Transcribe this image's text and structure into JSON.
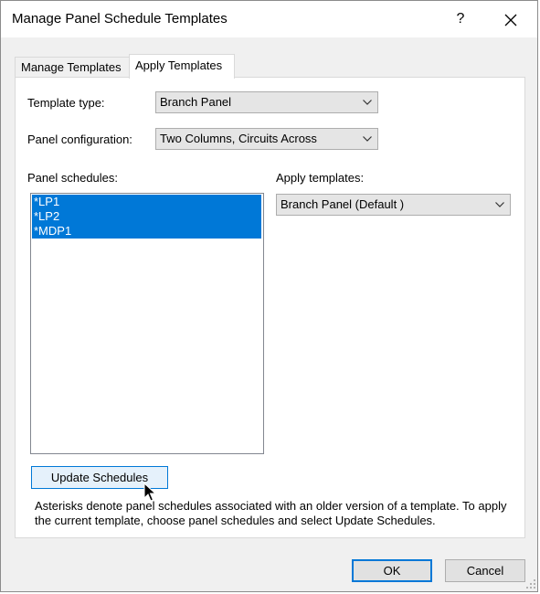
{
  "window": {
    "title": "Manage Panel Schedule Templates",
    "help_label": "?"
  },
  "tabs": [
    {
      "label": "Manage Templates",
      "active": false
    },
    {
      "label": "Apply Templates",
      "active": true
    }
  ],
  "form": {
    "template_type_label": "Template type:",
    "template_type_value": "Branch Panel",
    "panel_config_label": "Panel configuration:",
    "panel_config_value": "Two Columns, Circuits Across",
    "panel_schedules_label": "Panel schedules:",
    "panel_schedules": [
      "*LP1",
      "*LP2",
      "*MDP1"
    ],
    "apply_templates_label": "Apply templates:",
    "apply_templates_value": "Branch Panel (Default )"
  },
  "update_button_label": "Update Schedules",
  "note": "Asterisks denote panel schedules associated with an older version of a template. To apply the current template, choose panel schedules and select Update Schedules.",
  "buttons": {
    "ok": "OK",
    "cancel": "Cancel"
  },
  "colors": {
    "selection": "#0078d7",
    "focus_border": "#0078d7"
  }
}
